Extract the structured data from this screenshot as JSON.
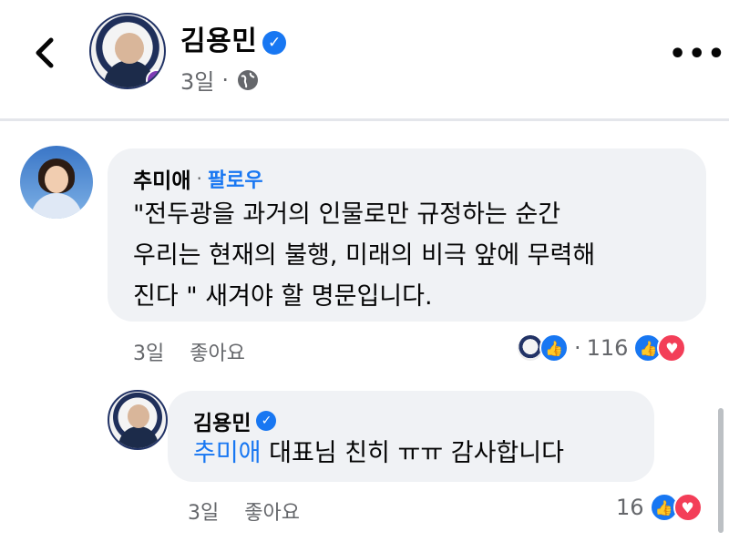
{
  "header": {
    "author_name": "김용민",
    "time": "3일",
    "separator": "·",
    "verified_icon": "verified-check-icon",
    "privacy_icon": "globe-icon",
    "more_label": "•••"
  },
  "comments": [
    {
      "author": "추미애",
      "separator": "·",
      "follow_label": "팔로우",
      "lines": [
        "\"전두광을 과거의 인물로만 규정하는 순간",
        "우리는 현재의 불행, 미래의 비극 앞에 무력해",
        "진다 \" 새겨야 할 명문입니다."
      ],
      "time": "3일",
      "like_label": "좋아요",
      "reply_count_sep": "·",
      "reaction_count": "116"
    },
    {
      "author": "김용민",
      "mention": "추미애",
      "text": " 대표님 친히 ㅠㅠ 감사합니다",
      "time": "3일",
      "like_label": "좋아요",
      "reaction_count": "16"
    }
  ],
  "colors": {
    "accent": "#1877f2",
    "love": "#f33e58",
    "bubble": "#f0f2f5",
    "muted": "#65676b"
  }
}
